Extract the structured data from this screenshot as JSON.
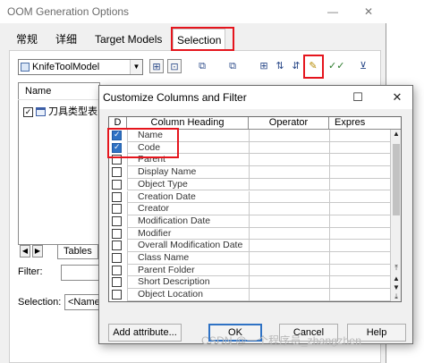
{
  "main_window": {
    "title": "OOM Generation Options",
    "tabs": [
      {
        "label": "常规",
        "active": false
      },
      {
        "label": "详细",
        "active": false
      },
      {
        "label": "Target Models",
        "active": false
      },
      {
        "label": "Selection",
        "active": true
      }
    ],
    "model_select": {
      "value": "KnifeToolModel"
    },
    "toolbar_icons": [
      "select-all-icon",
      "deselect-icon",
      "group-icon",
      "ungroup-icon",
      "tree-icon",
      "sort-asc-icon",
      "sort-desc-icon",
      "customize-filter-icon",
      "check-all-icon",
      "clear-filter-icon"
    ],
    "list": {
      "header": "Name",
      "items": [
        {
          "label": "刀具类型表",
          "checked": true
        }
      ]
    },
    "bottom_tab": "Tables",
    "filter_label": "Filter:",
    "selection_label": "Selection:",
    "selection_value": "<Name"
  },
  "dialog": {
    "title": "Customize Columns and Filter",
    "columns": [
      "D",
      "Column Heading",
      "Operator",
      "Expres"
    ],
    "rows": [
      {
        "label": "Name",
        "checked": true
      },
      {
        "label": "Code",
        "checked": true
      },
      {
        "label": "Parent",
        "checked": false
      },
      {
        "label": "Display Name",
        "checked": false
      },
      {
        "label": "Object Type",
        "checked": false
      },
      {
        "label": "Creation Date",
        "checked": false
      },
      {
        "label": "Creator",
        "checked": false
      },
      {
        "label": "Modification Date",
        "checked": false
      },
      {
        "label": "Modifier",
        "checked": false
      },
      {
        "label": "Overall Modification Date",
        "checked": false
      },
      {
        "label": "Class Name",
        "checked": false
      },
      {
        "label": "Parent Folder",
        "checked": false
      },
      {
        "label": "Short Description",
        "checked": false
      },
      {
        "label": "Object Location",
        "checked": false
      }
    ],
    "buttons": {
      "add_attribute": "Add attribute...",
      "ok": "OK",
      "cancel": "Cancel",
      "help": "Help"
    }
  },
  "watermark": "CSDN @一个程序员_zhangzhen",
  "colors": {
    "highlight": "#e5151d",
    "check_blue": "#2f72c4"
  }
}
